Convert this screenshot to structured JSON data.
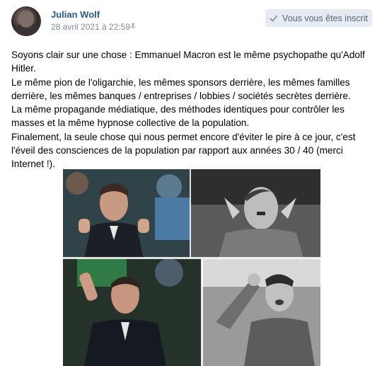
{
  "post": {
    "author": "Julian Wolf",
    "date": "28 avril 2021 à 22:59",
    "subscribe_label": "Vous vous êtes inscrit",
    "paragraphs": [
      "Soyons clair sur une chose : Emmanuel Macron est le même psychopathe qu'Adolf Hitler.",
      "Le même pion de l'oligarchie, les mêmes sponsors derrière, les mêmes familles derrière, les mêmes banques / entreprises / lobbies / sociétés secrètes derrière.",
      "La même propagande médiatique, des méthodes identiques pour contrôler les masses et la même hypnose collective de la population.",
      "Finalement, la seule chose qui nous permet encore d'éviter le pire à ce jour, c'est l'éveil des consciences de la population par rapport aux années 30 / 40 (merci Internet !)."
    ]
  },
  "icons": {
    "pin": "pin-icon",
    "check": "check-icon"
  },
  "colors": {
    "author_link": "#2a5885",
    "meta_text": "#818c99",
    "button_bg": "#e5ebf1",
    "button_text": "#55677d"
  }
}
